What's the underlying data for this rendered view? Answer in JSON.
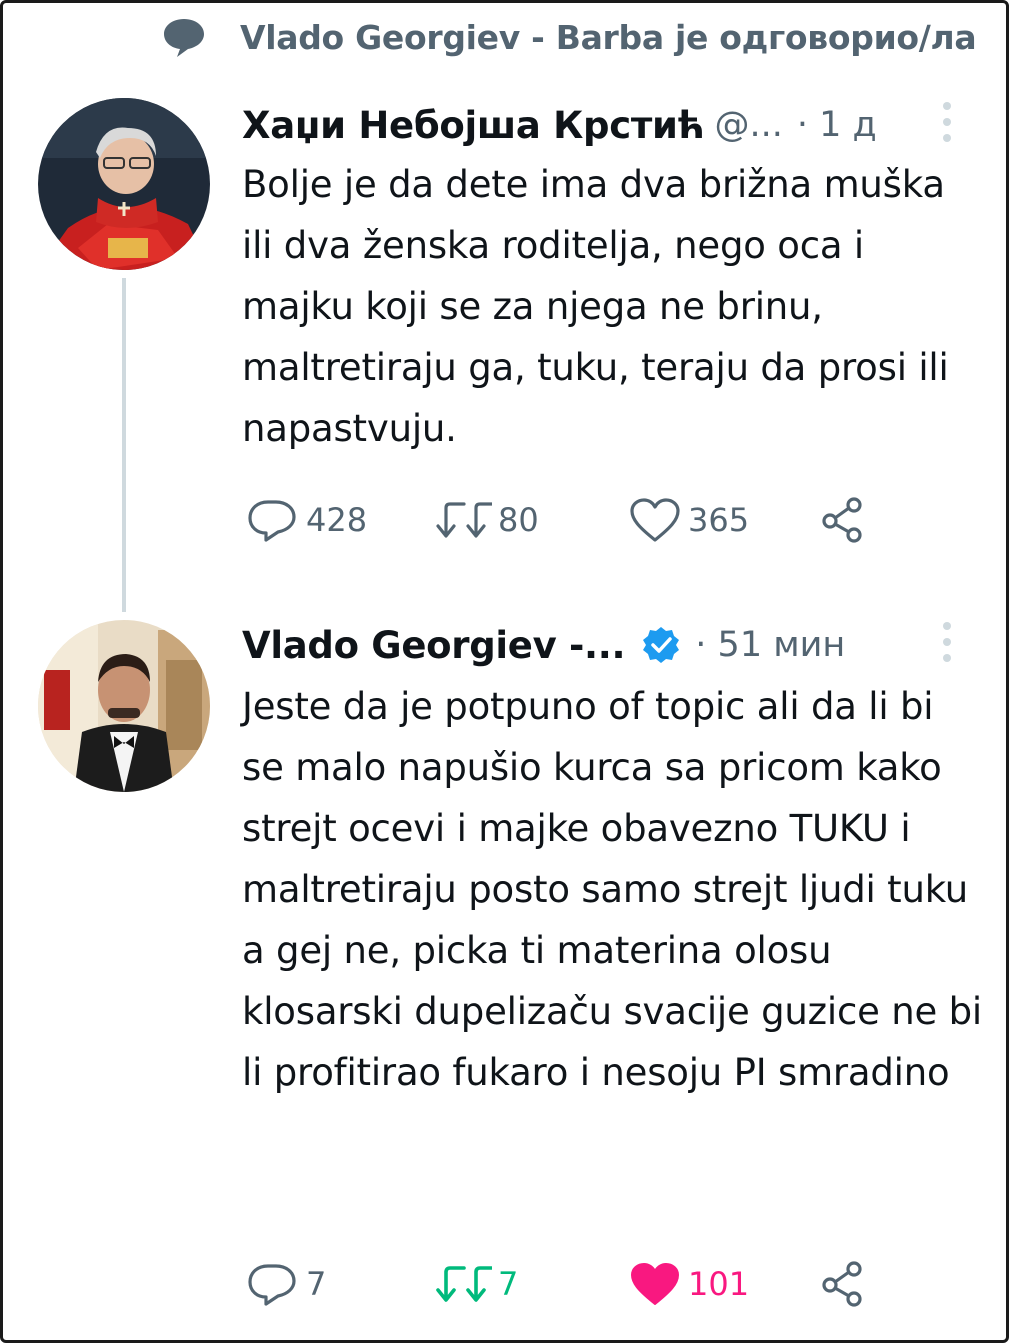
{
  "context": {
    "text": "Vlado Georgiev - Barba је одговорио/ла"
  },
  "tweets": [
    {
      "name": "Хаџи Небојша Крстић",
      "handle": "@...",
      "time": "· 1 д",
      "verified": false,
      "body": "Bolje je da dete ima dva brižna muška ili dva ženska roditelja, nego oca i majku koji se za njega ne brinu, maltretiraju ga, tuku, teraju da prosi ili napastvuju.",
      "replies": "428",
      "retweets": "80",
      "likes": "365",
      "liked": false,
      "retweeted": false
    },
    {
      "name": "Vlado Georgiev -...",
      "handle": "",
      "time": "· 51 мин",
      "verified": true,
      "body": "Jeste da je potpuno of topic ali da li bi se malo napušio kurca sa pricom kako strejt ocevi i majke obavezno TUKU i maltretiraju posto samo strejt ljudi tuku a gej ne, picka ti materina olosu klosarski dupelizaču svacije guzice ne bi li profitirao fukaro i nesoju PI smradino",
      "replies": "7",
      "retweets": "7",
      "likes": "101",
      "liked": true,
      "retweeted": true
    }
  ],
  "colors": {
    "text": "#0f1419",
    "secondary": "#536471",
    "verified": "#1d9bf0",
    "retweet_active": "#00ba7c",
    "like_active": "#f91880",
    "thread_line": "#cfd9de"
  },
  "icons": {
    "context": "speech-bubble-icon",
    "reply": "reply-icon",
    "retweet": "retweet-icon",
    "like": "heart-icon",
    "share": "share-icon",
    "more": "more-vertical-icon",
    "verified": "verified-badge-icon"
  }
}
